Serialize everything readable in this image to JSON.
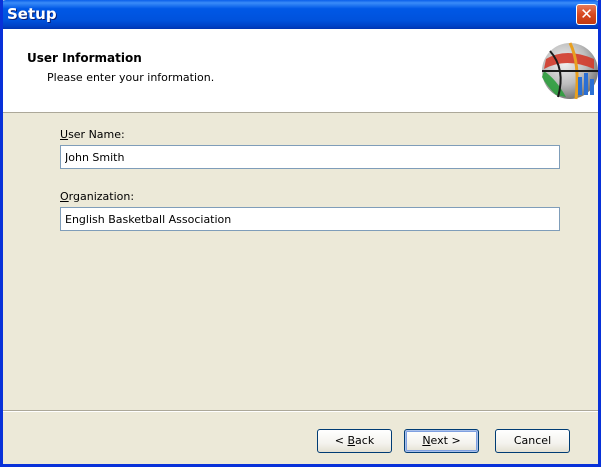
{
  "window": {
    "title": "Setup"
  },
  "header": {
    "title": "User Information",
    "subtitle": "Please enter your information."
  },
  "form": {
    "user_name_label": "User Name:",
    "user_name_accel": "U",
    "user_name_rest": "ser Name:",
    "user_name_value": "John Smith",
    "organization_label": "Organization:",
    "organization_accel": "O",
    "organization_rest": "rganization:",
    "organization_value": "English Basketball Association"
  },
  "buttons": {
    "back_prefix": "< ",
    "back_accel": "B",
    "back_rest": "ack",
    "next_accel": "N",
    "next_rest": "ext >",
    "cancel": "Cancel"
  },
  "icons": {
    "close": "close-icon",
    "logo": "basketball-logo-icon"
  },
  "colors": {
    "titlebar": "#0058E6",
    "dialog_bg": "#ECE9D8",
    "header_bg": "#FFFFFF",
    "close_button": "#D8481F",
    "input_border": "#7F9DB9"
  }
}
